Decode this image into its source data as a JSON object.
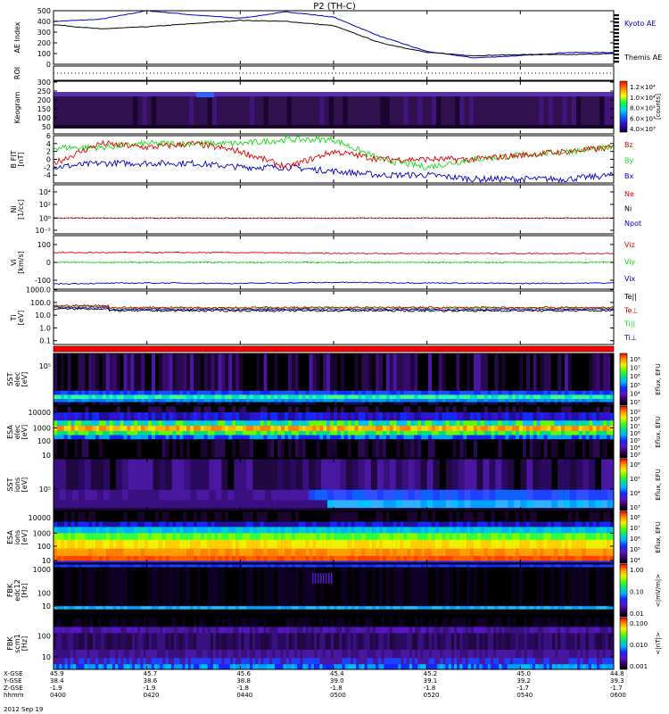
{
  "title": "P2 (TH-C)",
  "date_label": "2012 Sep 19",
  "colors": {
    "red": "#e00000",
    "green": "#10dd10",
    "blue": "#0000cc",
    "black": "#000000"
  },
  "time_axis": {
    "ticks": [
      "0400",
      "0420",
      "0440",
      "0500",
      "0520",
      "0540",
      "0600"
    ],
    "rows": [
      {
        "label": "X-GSE",
        "values": [
          "45.9",
          "45.7",
          "45.6",
          "45.4",
          "45.2",
          "45.0",
          "44.8"
        ]
      },
      {
        "label": "Y-GSE",
        "values": [
          "38.4",
          "38.6",
          "38.8",
          "39.0",
          "39.1",
          "39.2",
          "39.3"
        ]
      },
      {
        "label": "Z-GSE",
        "values": [
          "-1.9",
          "-1.9",
          "-1.8",
          "-1.8",
          "-1.8",
          "-1.7",
          "-1.7"
        ]
      },
      {
        "label": "hhmm",
        "values": [
          "0400",
          "0420",
          "0440",
          "0500",
          "0520",
          "0540",
          "0600"
        ]
      }
    ]
  },
  "panels": [
    {
      "id": "ae",
      "ylabel": [
        "AE Index"
      ],
      "ticks": [
        "0",
        "100",
        "200",
        "300",
        "400",
        "500"
      ],
      "legend": [
        "Kyoto AE",
        "Themis AE"
      ]
    },
    {
      "id": "roi",
      "ylabel": [
        "ROI"
      ],
      "ticks": []
    },
    {
      "id": "keogram",
      "ylabel": [
        "Keogram"
      ],
      "ticks": [
        "50",
        "100",
        "150",
        "200",
        "250",
        "300"
      ],
      "colorbar": [
        "1.2×10⁴",
        "1.0×10⁴",
        "8.0×10³",
        "6.0×10³",
        "4.0×10³"
      ],
      "cbunits": "[counts]"
    },
    {
      "id": "bfit",
      "ylabel": [
        "B FIT",
        "[nT]"
      ],
      "ticks": [
        "-4",
        "-2",
        "0",
        "2",
        "4",
        "6"
      ],
      "legend": [
        "Bz",
        "By",
        "Bx"
      ]
    },
    {
      "id": "ni",
      "ylabel": [
        "Ni",
        "[1/cc]"
      ],
      "ticks": [
        "10⁻²",
        "10⁰",
        "10²",
        "10⁴"
      ],
      "legend": [
        "Ne",
        "Ni",
        "Npot"
      ]
    },
    {
      "id": "vi",
      "ylabel": [
        "Vi",
        "[km/s]"
      ],
      "ticks": [
        "-100",
        "0",
        "100"
      ],
      "legend": [
        "Viz",
        "Viy",
        "Vix"
      ]
    },
    {
      "id": "ti",
      "ylabel": [
        "Ti",
        "[eV]"
      ],
      "ticks": [
        "0.1",
        "1.0",
        "10.0",
        "100.0",
        "1000.0"
      ],
      "legend": [
        "Te||",
        "Te⊥",
        "Ti||",
        "Ti⊥"
      ]
    },
    {
      "id": "sst_e",
      "ylabel": [
        "SST",
        "elec",
        "[eV]"
      ],
      "ticks": [
        "10⁵"
      ],
      "colorbar": [
        "10⁸",
        "10⁷",
        "10⁶",
        "10⁵",
        "10⁴",
        "10³"
      ],
      "cbunits": "Eflux, EFU"
    },
    {
      "id": "esa_e",
      "ylabel": [
        "ESA",
        "elec",
        "[eV]"
      ],
      "ticks": [
        "10",
        "100",
        "1000",
        "10000"
      ],
      "colorbar": [
        "10⁹",
        "10⁸",
        "10⁷",
        "10⁶",
        "10⁵",
        "10⁴",
        "10³"
      ],
      "cbunits": "Eflux, EFU"
    },
    {
      "id": "sst_i",
      "ylabel": [
        "SST",
        "ions",
        "[eV]"
      ],
      "ticks": [
        "10⁵"
      ],
      "colorbar": [
        "10⁶",
        "10⁵",
        "10⁴",
        "10³"
      ],
      "cbunits": "Eflux, EFU"
    },
    {
      "id": "esa_i",
      "ylabel": [
        "ESA",
        "ions",
        "[eV]"
      ],
      "ticks": [
        "10",
        "100",
        "1000",
        "10000"
      ],
      "colorbar": [
        "10⁸",
        "10⁷",
        "10⁶",
        "10⁵",
        "10⁴"
      ],
      "cbunits": "Eflux, EFU"
    },
    {
      "id": "fbk_e",
      "ylabel": [
        "FBK",
        "edc12",
        "[Hz]"
      ],
      "ticks": [
        "10",
        "100",
        "1000"
      ],
      "colorbar": [
        "1.00",
        "0.10",
        "0.01"
      ],
      "cbunits": "<|mV/m|>"
    },
    {
      "id": "fbk_b",
      "ylabel": [
        "FBK",
        "scm1",
        "[Hz]"
      ],
      "ticks": [
        "10",
        "100"
      ],
      "colorbar": [
        "0.100",
        "0.010",
        "0.001"
      ],
      "cbunits": "<|nT|>"
    }
  ],
  "chart_data": [
    {
      "type": "line",
      "name": "AE Index",
      "ylim": [
        0,
        500
      ],
      "x": [
        0,
        10,
        20,
        30,
        40,
        50,
        60,
        70,
        80,
        90,
        100,
        110,
        120
      ],
      "series": [
        {
          "name": "Kyoto AE",
          "color": "#0000cc",
          "values": [
            400,
            420,
            500,
            460,
            430,
            490,
            440,
            260,
            120,
            60,
            80,
            110,
            110
          ]
        },
        {
          "name": "Themis AE",
          "color": "#000000",
          "values": [
            370,
            330,
            350,
            380,
            410,
            400,
            360,
            200,
            110,
            80,
            90,
            90,
            100
          ]
        }
      ]
    },
    {
      "type": "line",
      "name": "B FIT",
      "ylim": [
        -6,
        6
      ],
      "x": [
        0,
        10,
        20,
        30,
        40,
        50,
        60,
        70,
        80,
        90,
        100,
        110,
        120
      ],
      "series": [
        {
          "name": "Bz",
          "color": "#e00000",
          "values": [
            -1,
            4,
            3,
            4,
            2,
            -2,
            2,
            0,
            0,
            0,
            1,
            2,
            3
          ]
        },
        {
          "name": "By",
          "color": "#10dd10",
          "values": [
            3,
            3,
            4,
            4,
            4,
            5,
            5,
            0,
            -2,
            0,
            1,
            2,
            3
          ]
        },
        {
          "name": "Bx",
          "color": "#0000cc",
          "values": [
            -2,
            -1,
            -1,
            -1,
            -2,
            -2,
            -3,
            -4,
            -4,
            -5,
            -5,
            -5,
            -4
          ]
        }
      ]
    },
    {
      "type": "line",
      "name": "Vi",
      "ylim": [
        -150,
        150
      ],
      "x": [
        0,
        20,
        40,
        60,
        80,
        100,
        120
      ],
      "series": [
        {
          "name": "Viz",
          "color": "#e00000",
          "values": [
            55,
            55,
            55,
            50,
            50,
            50,
            50
          ]
        },
        {
          "name": "Viy",
          "color": "#10dd10",
          "values": [
            0,
            0,
            0,
            0,
            0,
            0,
            0
          ]
        },
        {
          "name": "Vix",
          "color": "#0000cc",
          "values": [
            -120,
            -115,
            -118,
            -112,
            -115,
            -118,
            -115
          ]
        }
      ]
    }
  ]
}
